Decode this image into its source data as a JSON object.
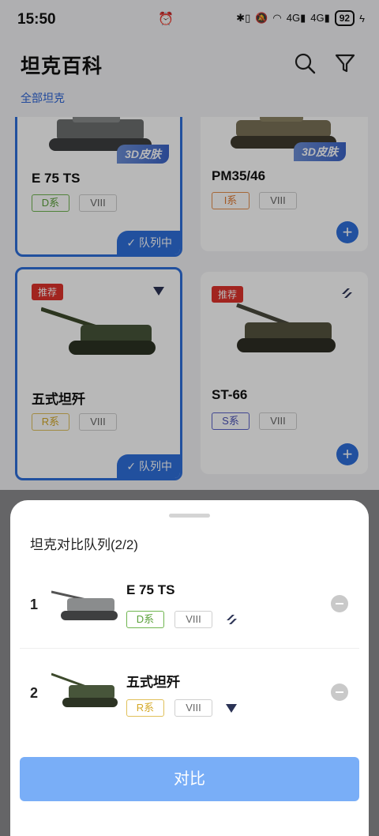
{
  "status_bar": {
    "time": "15:50",
    "battery": "92",
    "icons": [
      "bluetooth-battery-icon",
      "mute-icon",
      "wifi-icon",
      "signal-4g-icon",
      "signal-4g-icon",
      "charging-icon"
    ]
  },
  "header": {
    "title": "坦克百科",
    "breadcrumb": "全部坦克"
  },
  "cards": [
    {
      "name": "E 75 TS",
      "nation": "D系",
      "tier": "VIII",
      "badge": "3D皮肤",
      "status": "✓ 队列中"
    },
    {
      "name": "PM35/46",
      "nation": "I系",
      "tier": "VIII",
      "badge": "3D皮肤"
    },
    {
      "name": "五式坦歼",
      "nation": "R系",
      "tier": "VIII",
      "recommend": "推荐",
      "status": "✓ 队列中",
      "type_icon": "td-triangle-icon"
    },
    {
      "name": "ST-66",
      "nation": "S系",
      "tier": "VIII",
      "recommend": "推荐",
      "type_icon": "heavy-tank-icon"
    }
  ],
  "compare_sheet": {
    "title": "坦克对比队列(2/2)",
    "rows": [
      {
        "index": "1",
        "name": "E 75 TS",
        "nation": "D系",
        "tier": "VIII",
        "type_icon": "heavy-tank-icon"
      },
      {
        "index": "2",
        "name": "五式坦歼",
        "nation": "R系",
        "tier": "VIII",
        "type_icon": "td-triangle-icon"
      }
    ],
    "compare_button": "对比"
  },
  "colors": {
    "accent": "#2f6fdc",
    "compare_button": "#79aef7",
    "recommend": "#e0322c"
  }
}
